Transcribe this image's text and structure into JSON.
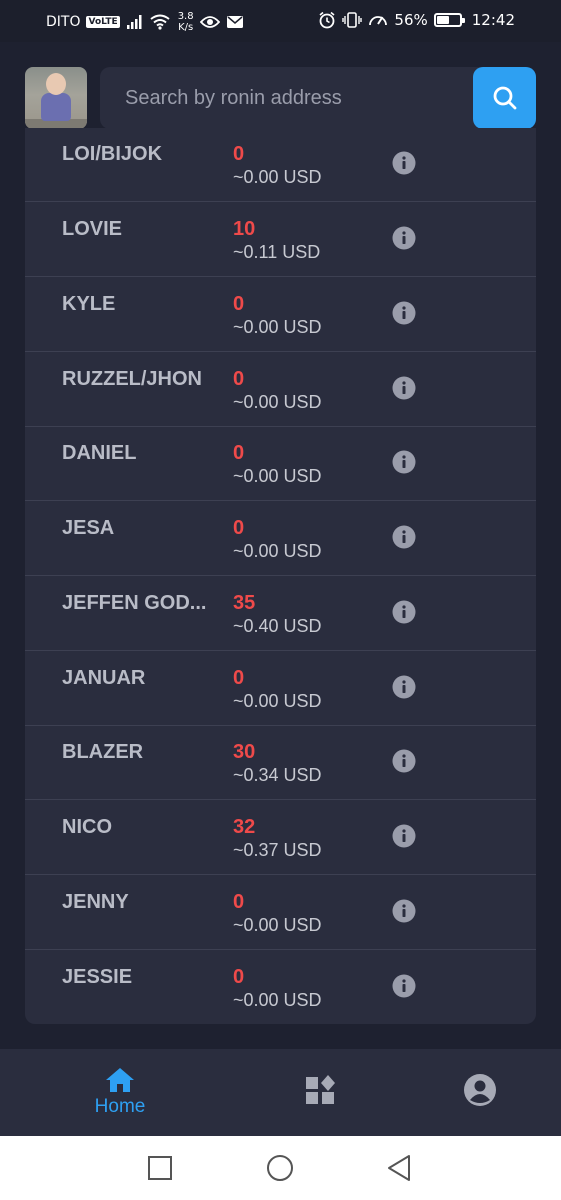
{
  "status_bar": {
    "carrier": "DITO",
    "volte": "VoLTE",
    "net_speed_value": "3.8",
    "net_speed_unit": "K/s",
    "battery_percent": "56%",
    "battery_level": 0.56,
    "time": "12:42"
  },
  "header": {
    "search_placeholder": "Search by ronin address"
  },
  "scholars": [
    {
      "name": "LOI/BIJOK",
      "slp": "0",
      "usd": "~0.00 USD"
    },
    {
      "name": "LOVIE",
      "slp": "10",
      "usd": "~0.11 USD"
    },
    {
      "name": "KYLE",
      "slp": "0",
      "usd": "~0.00 USD"
    },
    {
      "name": "RUZZEL/JHON",
      "slp": "0",
      "usd": "~0.00 USD"
    },
    {
      "name": "DANIEL",
      "slp": "0",
      "usd": "~0.00 USD"
    },
    {
      "name": "JESA",
      "slp": "0",
      "usd": "~0.00 USD"
    },
    {
      "name": "JEFFEN GOD...",
      "slp": "35",
      "usd": "~0.40 USD"
    },
    {
      "name": "JANUAR",
      "slp": "0",
      "usd": "~0.00 USD"
    },
    {
      "name": "BLAZER",
      "slp": "30",
      "usd": "~0.34 USD"
    },
    {
      "name": "NICO",
      "slp": "32",
      "usd": "~0.37 USD"
    },
    {
      "name": "JENNY",
      "slp": "0",
      "usd": "~0.00 USD"
    },
    {
      "name": "JESSIE",
      "slp": "0",
      "usd": "~0.00 USD"
    }
  ],
  "bottom_nav": {
    "home_label": "Home",
    "items": [
      {
        "icon": "home-icon",
        "active": true
      },
      {
        "icon": "widgets-icon",
        "active": false
      },
      {
        "icon": "account-icon",
        "active": false
      }
    ]
  },
  "colors": {
    "background": "#1e2130",
    "card": "#2a2d3e",
    "accent": "#2ea0f2",
    "slp_value": "#ef4a4a",
    "name_text": "#b9bcc7"
  }
}
